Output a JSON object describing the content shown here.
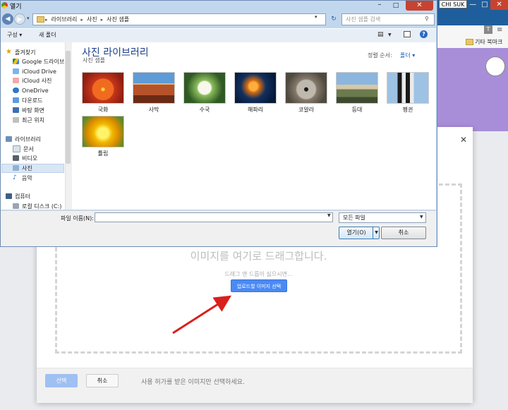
{
  "background_browser": {
    "user_label": "CHI SUK",
    "bookmark_other": "기타 북마크",
    "close_glyph": "✕",
    "min_glyph": "—",
    "max_glyph": "□",
    "t_icon": "T"
  },
  "upload_dialog": {
    "close_glyph": "✕",
    "drop_title": "이미지를 여기로 드래그합니다.",
    "drop_subtitle": "드래그 앤 드롭이 싫으시면...",
    "upload_button": "업로드할 이미지 선택",
    "select_button": "선택",
    "cancel_button": "취소",
    "footer_note": "사용 허가를 받은 이미지만 선택하세요."
  },
  "open_dialog": {
    "title": "열기",
    "breadcrumb": [
      "라이브러리",
      "사진",
      "사진 샘플"
    ],
    "search_placeholder": "사진 샘플 검색",
    "toolbar": {
      "organize": "구성 ▾",
      "new_folder": "새 폴더"
    },
    "nav": {
      "favorites_header": "즐겨찾기",
      "favorites": [
        "Google 드라이브",
        "iCloud Drive",
        "iCloud 사진",
        "OneDrive",
        "다운로드",
        "바탕 화면",
        "최근 위치"
      ],
      "libraries_header": "라이브러리",
      "libraries": [
        "문서",
        "비디오",
        "사진",
        "음악"
      ],
      "computer_header": "컴퓨터",
      "computer": [
        "로컬 디스크 (C:)"
      ]
    },
    "library_title": "사진 라이브러리",
    "library_subtitle": "사진 샘플",
    "sort_label": "정렬 순서:",
    "sort_value": "폴더 ▾",
    "files": [
      "국화",
      "사막",
      "수국",
      "해파리",
      "코알라",
      "등대",
      "펭귄",
      "튤립"
    ],
    "filename_label": "파일 이름(N):",
    "filetype_value": "모든 파일",
    "open_button": "열기(O)",
    "cancel_button": "취소"
  },
  "colors": {
    "accent_blue": "#4a8af4",
    "library_title": "#1d3f8a",
    "arrow_red": "#d9201c",
    "chrome_purple": "#a88ed9"
  }
}
